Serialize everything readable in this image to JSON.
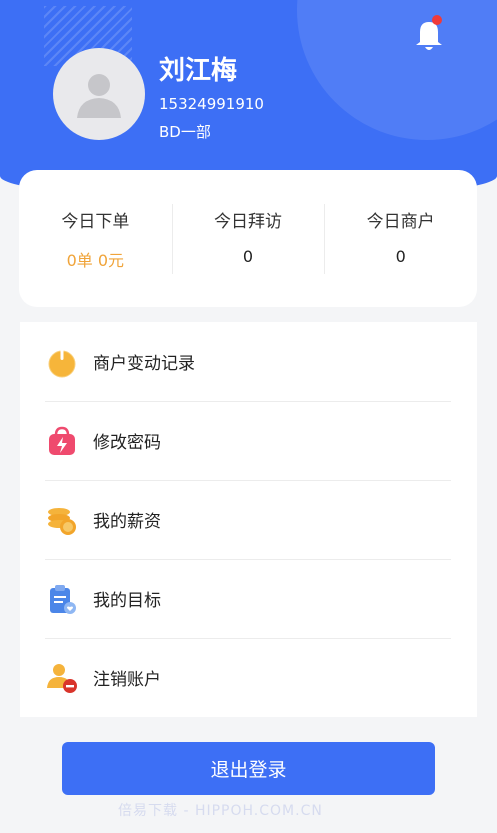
{
  "profile": {
    "name": "刘江梅",
    "phone": "15324991910",
    "department": "BD一部",
    "avatar_icon": "user-silhouette-icon",
    "notification_icon": "bell-icon",
    "notification_dot_color": "#f03a3a"
  },
  "stats": [
    {
      "label": "今日下单",
      "value": "0单 0元",
      "color": "#f0a43a"
    },
    {
      "label": "今日拜访",
      "value": "0"
    },
    {
      "label": "今日商户",
      "value": "0"
    }
  ],
  "menu": [
    {
      "label": "商户变动记录",
      "icon": "power-orange-icon"
    },
    {
      "label": "修改密码",
      "icon": "lightning-bag-icon"
    },
    {
      "label": "我的薪资",
      "icon": "coin-stack-icon"
    },
    {
      "label": "我的目标",
      "icon": "clipboard-heart-icon"
    },
    {
      "label": "注销账户",
      "icon": "user-remove-icon"
    }
  ],
  "logout_label": "退出登录",
  "watermark": "倍易下载 - HIPPOH.COM.CN",
  "colors": {
    "primary": "#3d6ff5",
    "accent_orange": "#f0a43a"
  }
}
